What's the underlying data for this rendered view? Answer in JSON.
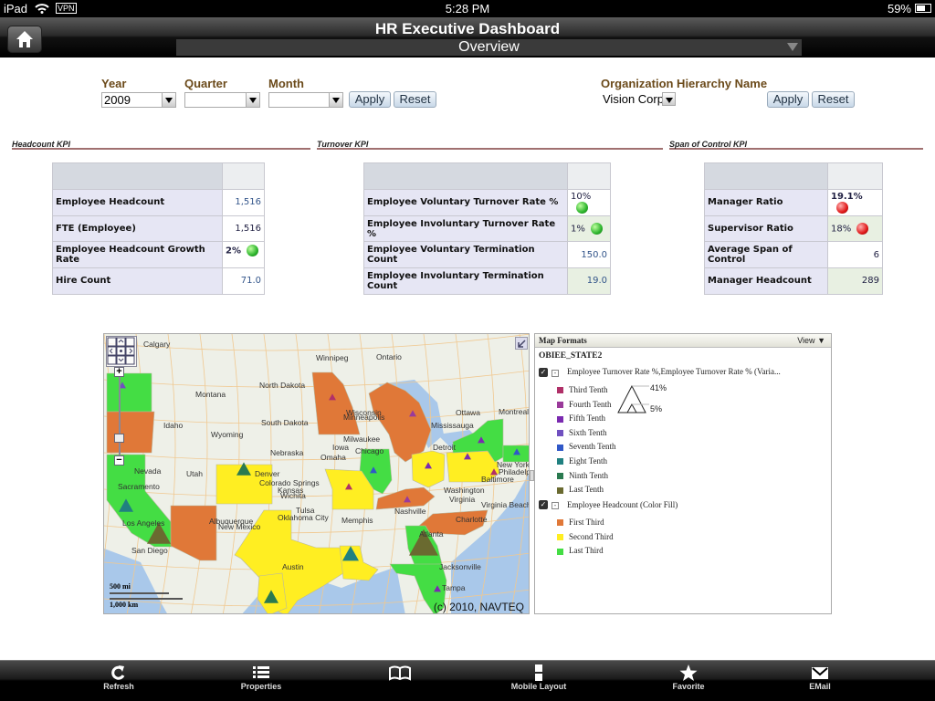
{
  "status_bar": {
    "device": "iPad",
    "vpn": "VPN",
    "time": "5:28 PM",
    "battery": "59%"
  },
  "header": {
    "title": "HR Executive Dashboard",
    "page_selector": "Overview"
  },
  "filters": {
    "year": {
      "label": "Year",
      "value": "2009"
    },
    "quarter": {
      "label": "Quarter",
      "value": ""
    },
    "month": {
      "label": "Month",
      "value": ""
    },
    "apply": "Apply",
    "reset": "Reset",
    "org": {
      "label": "Organization Hierarchy Name",
      "value": "Vision Corp"
    },
    "apply2": "Apply",
    "reset2": "Reset"
  },
  "headcount_kpi": {
    "title": "Headcount KPI",
    "rows": [
      {
        "label": "Employee Headcount",
        "value": "1,516"
      },
      {
        "label": "FTE (Employee)",
        "value": "1,516"
      },
      {
        "label": "Employee Headcount Growth Rate",
        "value": "2%",
        "status": "green"
      },
      {
        "label": "Hire Count",
        "value": "71.0"
      }
    ]
  },
  "turnover_kpi": {
    "title": "Turnover KPI",
    "rows": [
      {
        "label": "Employee Voluntary Turnover Rate %",
        "value": "10%",
        "status": "green"
      },
      {
        "label": "Employee Involuntary Turnover Rate %",
        "value": "1%",
        "status": "green"
      },
      {
        "label": "Employee Voluntary Termination Count",
        "value": "150.0"
      },
      {
        "label": "Employee Involuntary Termination Count",
        "value": "19.0"
      }
    ]
  },
  "span_kpi": {
    "title": "Span of Control KPI",
    "rows": [
      {
        "label": "Manager Ratio",
        "value": "19.1%",
        "status": "red"
      },
      {
        "label": "Supervisor Ratio",
        "value": "18%",
        "status": "red"
      },
      {
        "label": "Average Span of Control",
        "value": "6"
      },
      {
        "label": "Manager Headcount",
        "value": "289"
      }
    ]
  },
  "map": {
    "copyright": "(c) 2010, NAVTEQ",
    "scale_mi": "500 mi",
    "scale_km": "1,000 km",
    "labels": [
      "Calgary",
      "Winnipeg",
      "Ontario",
      "North Dakota",
      "Montana",
      "South Dakota",
      "Idaho",
      "Wyoming",
      "Wisconsin",
      "Minneapolis",
      "Milwaukee",
      "Iowa",
      "Nebraska",
      "Omaha",
      "Nevada",
      "Utah",
      "Sacramento",
      "Kansas",
      "Colorado Springs",
      "Wichita",
      "Tulsa",
      "Oklahoma City",
      "Memphis",
      "Nashville",
      "Albuquerque",
      "New Mexico",
      "San Diego",
      "Los Angeles",
      "Jacksonville",
      "Washington",
      "Virginia",
      "Virginia Beach",
      "Ottawa",
      "Montreal",
      "Mississauga",
      "New York",
      "Philadelphia",
      "Baltimore",
      "Chicago",
      "Denver",
      "Atlanta",
      "Charlotte",
      "Austin",
      "Tampa",
      "Detroit"
    ],
    "colors": {
      "first_third": "#e07838",
      "second_third": "#ffee22",
      "last_third": "#44dd44",
      "water": "#a9c8ea"
    }
  },
  "legend": {
    "header": "Map Formats",
    "view": "View",
    "layer": "OBIEE_STATE2",
    "theme1": {
      "title": "Employee Turnover Rate %,Employee Turnover Rate % (Varia...",
      "size_max": "41%",
      "size_min": "5%",
      "items": [
        {
          "label": "Third Tenth",
          "color": "#b03068"
        },
        {
          "label": "Fourth Tenth",
          "color": "#9a3a9a"
        },
        {
          "label": "Fifth Tenth",
          "color": "#7a2ab0"
        },
        {
          "label": "Sixth Tenth",
          "color": "#7050c0"
        },
        {
          "label": "Seventh Tenth",
          "color": "#3058c8"
        },
        {
          "label": "Eight Tenth",
          "color": "#208080"
        },
        {
          "label": "Ninth Tenth",
          "color": "#2a7a50"
        },
        {
          "label": "Last Tenth",
          "color": "#6a6a30"
        }
      ]
    },
    "theme2": {
      "title": "Employee Headcount (Color Fill)",
      "items": [
        {
          "label": "First Third",
          "color": "#e07838"
        },
        {
          "label": "Second Third",
          "color": "#ffee22"
        },
        {
          "label": "Last Third",
          "color": "#44dd44"
        }
      ]
    }
  },
  "toolbar": {
    "refresh": "Refresh",
    "properties": "Properties",
    "bookmark": "",
    "mobile_layout": "Mobile Layout",
    "favorite": "Favorite",
    "email": "EMail"
  }
}
